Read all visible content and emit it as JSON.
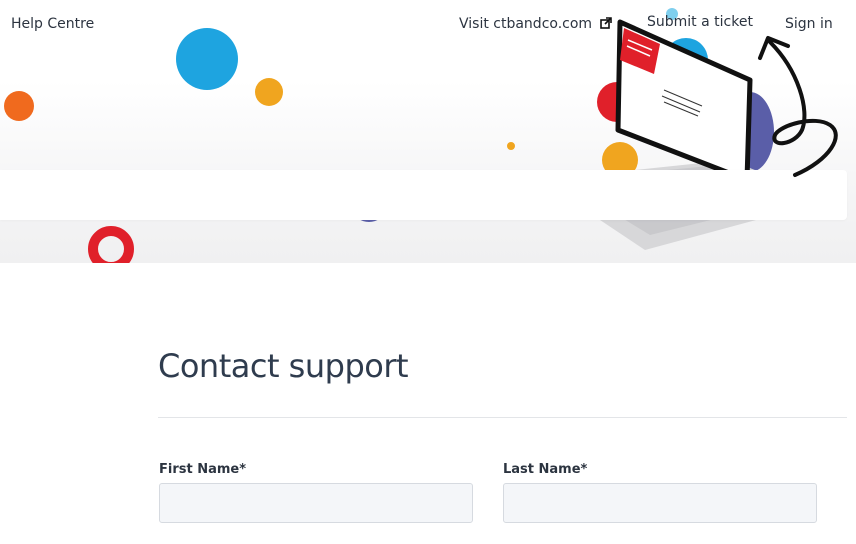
{
  "nav": {
    "brand": "Help Centre",
    "visit_label": "Visit ctbandco.com",
    "visit_icon": "external-link-icon",
    "submit_ticket": "Submit a ticket",
    "sign_in": "Sign in"
  },
  "hero": {
    "search_placeholder": ""
  },
  "form": {
    "title": "Contact support",
    "first_name_label": "First Name*",
    "first_name_value": "",
    "last_name_label": "Last Name*",
    "last_name_value": ""
  },
  "colors": {
    "blue": "#1ea4e0",
    "orange": "#f06a1e",
    "yellow": "#f0a51f",
    "red": "#e0202a",
    "purple": "#5a5ea8",
    "text": "#2c3440",
    "title": "#2f3c4e"
  }
}
